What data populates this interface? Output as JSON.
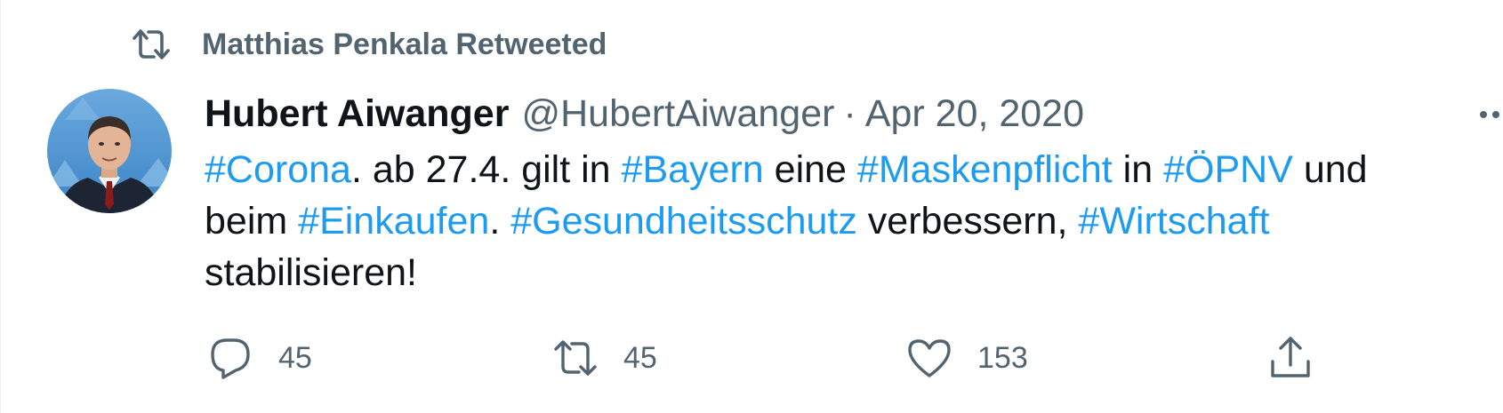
{
  "retweet_context": {
    "label": "Matthias Penkala Retweeted",
    "icon": "retweet-icon"
  },
  "tweet": {
    "author_name": "Hubert Aiwanger",
    "author_handle": "@HubertAiwanger",
    "separator": "·",
    "date": "Apr 20, 2020",
    "body_lines": [
      [
        {
          "text": "#Corona",
          "hashtag": true
        },
        {
          "text": ". ab 27.4. gilt in ",
          "hashtag": false
        },
        {
          "text": "#Bayern",
          "hashtag": true
        },
        {
          "text": " eine ",
          "hashtag": false
        },
        {
          "text": "#Maskenpflicht",
          "hashtag": true
        },
        {
          "text": " in ",
          "hashtag": false
        },
        {
          "text": "#ÖPNV",
          "hashtag": true
        },
        {
          "text": " und",
          "hashtag": false
        }
      ],
      [
        {
          "text": "beim ",
          "hashtag": false
        },
        {
          "text": "#Einkaufen",
          "hashtag": true
        },
        {
          "text": ". ",
          "hashtag": false
        },
        {
          "text": "#Gesundheitsschutz",
          "hashtag": true
        },
        {
          "text": " verbessern, ",
          "hashtag": false
        },
        {
          "text": "#Wirtschaft",
          "hashtag": true
        }
      ],
      [
        {
          "text": "stabilisieren!",
          "hashtag": false
        }
      ]
    ]
  },
  "actions": {
    "reply": {
      "icon": "reply-icon",
      "count": "45"
    },
    "retweet": {
      "icon": "retweet-icon",
      "count": "45"
    },
    "like": {
      "icon": "heart-icon",
      "count": "153"
    },
    "share": {
      "icon": "share-icon"
    }
  },
  "colors": {
    "accent": "#1d9bf0",
    "secondary_text": "#536471",
    "primary_text": "#0f1419"
  }
}
